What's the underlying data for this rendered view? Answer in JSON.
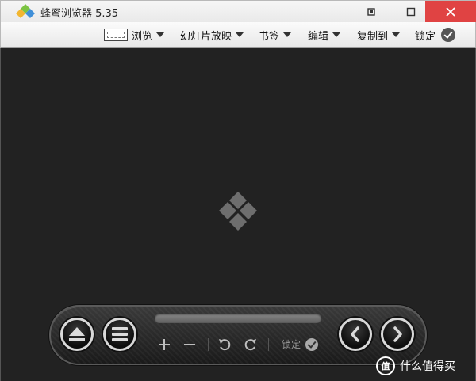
{
  "window": {
    "title": "蜂蜜浏览器 5.35"
  },
  "menu": {
    "items": [
      {
        "label": "浏览",
        "icon": "browse-frame-icon"
      },
      {
        "label": "幻灯片放映"
      },
      {
        "label": "书签"
      },
      {
        "label": "编辑"
      },
      {
        "label": "复制到"
      }
    ],
    "lock_label": "锁定"
  },
  "controls": {
    "eject_icon": "eject-icon",
    "menu_icon": "list-icon",
    "zoom_in_icon": "plus-icon",
    "zoom_out_icon": "minus-icon",
    "rotate_left_icon": "rotate-left-icon",
    "rotate_right_icon": "rotate-right-icon",
    "prev_icon": "chevron-left-icon",
    "next_icon": "chevron-right-icon",
    "lock_label": "锁定"
  },
  "watermark": {
    "badge": "值",
    "text": "什么值得买"
  },
  "colors": {
    "viewer_bg": "#222222",
    "close_button": "#e04343",
    "logo_green": "#7cc443",
    "logo_yellow": "#f2b630",
    "logo_blue": "#3f8fd8"
  }
}
